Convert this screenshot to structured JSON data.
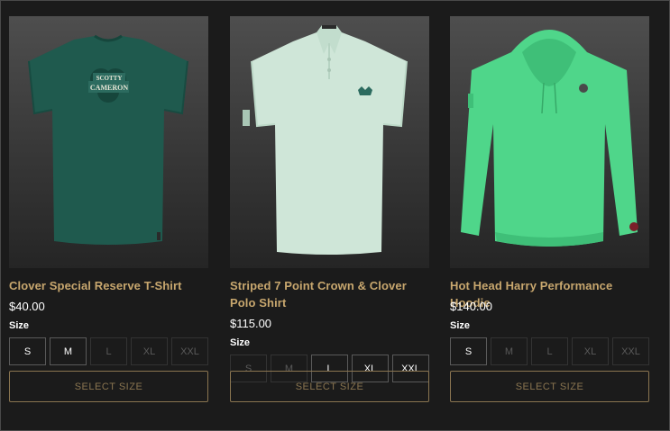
{
  "products": [
    {
      "name": "Clover Special Reserve T-Shirt",
      "price": "$40.00",
      "size_label": "Size",
      "sizes": [
        {
          "label": "S",
          "available": true
        },
        {
          "label": "M",
          "available": true
        },
        {
          "label": "L",
          "available": false
        },
        {
          "label": "XL",
          "available": false
        },
        {
          "label": "XXL",
          "available": false
        }
      ],
      "button": "SELECT SIZE",
      "image": "tshirt-image",
      "color": "#1f5a4e"
    },
    {
      "name": "Striped 7 Point Crown & Clover Polo Shirt",
      "price": "$115.00",
      "size_label": "Size",
      "sizes": [
        {
          "label": "S",
          "available": false
        },
        {
          "label": "M",
          "available": false
        },
        {
          "label": "L",
          "available": true
        },
        {
          "label": "XL",
          "available": true
        },
        {
          "label": "XXL",
          "available": true
        }
      ],
      "button": "SELECT SIZE",
      "image": "polo-image",
      "color": "#cfe6d8"
    },
    {
      "name": "Hot Head Harry Performance Hoodie",
      "price": "$140.00",
      "size_label": "Size",
      "sizes": [
        {
          "label": "S",
          "available": true
        },
        {
          "label": "M",
          "available": false
        },
        {
          "label": "L",
          "available": false
        },
        {
          "label": "XL",
          "available": false
        },
        {
          "label": "XXL",
          "available": false
        }
      ],
      "button": "SELECT SIZE",
      "image": "hoodie-image",
      "color": "#4fd68a"
    }
  ],
  "theme": {
    "background": "#1b1b1b",
    "accent": "#c8a76e",
    "button_border": "#8a7550"
  },
  "artwork": {
    "tshirt_logo_top": "SCOTTY",
    "tshirt_logo_bottom": "CAMERON"
  }
}
